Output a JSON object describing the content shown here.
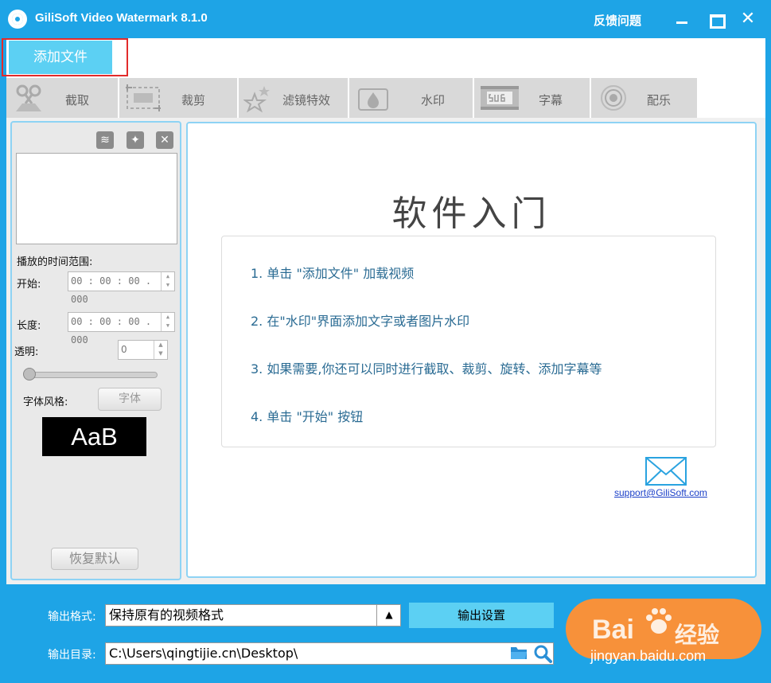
{
  "window": {
    "title": "GiliSoft Video Watermark 8.1.0",
    "feedback": "反馈问题",
    "close_glyph": "✕"
  },
  "add_file": {
    "label": "添加文件"
  },
  "toolbar": {
    "tools": [
      {
        "label": "截取",
        "icon": "scissors-icon"
      },
      {
        "label": "裁剪",
        "icon": "crop-icon"
      },
      {
        "label": "滤镜特效",
        "icon": "stars-icon"
      },
      {
        "label": "水印",
        "icon": "water-drop-icon"
      },
      {
        "label": "字幕",
        "icon": "subtitle-icon"
      },
      {
        "label": "配乐",
        "icon": "music-ring-icon"
      }
    ]
  },
  "left_panel": {
    "play_range_label": "播放的时间范围:",
    "start_label": "开始:",
    "start_value": "00 : 00 : 00 . 000",
    "length_label": "长度:",
    "length_value": "00 : 00 : 00 . 000",
    "opacity_label": "透明:",
    "opacity_value": "0",
    "font_style_label": "字体风格:",
    "font_button": "字体",
    "font_preview": "AaB",
    "restore_default": "恢复默认"
  },
  "guide": {
    "title": "软件入门",
    "steps": [
      "1. 单击 \"添加文件\" 加载视频",
      "2. 在\"水印\"界面添加文字或者图片水印",
      "3. 如果需要,你还可以同时进行截取、裁剪、旋转、添加字幕等",
      "4. 单击 \"开始\" 按钮"
    ],
    "support_email": "support@GiliSoft.com"
  },
  "bottom": {
    "format_label": "输出格式:",
    "format_value": "保持原有的视频格式",
    "output_settings": "输出设置",
    "dir_label": "输出目录:",
    "dir_value": "C:\\Users\\qingtijie.cn\\Desktop\\"
  },
  "watermark": {
    "brand_left": "Bai",
    "brand_right": "经验",
    "url": "jingyan.baidu.com"
  },
  "colors": {
    "frame": "#1ea4e6",
    "accent_button": "#5cd0f3",
    "start_button": "#f7913a",
    "highlight": "#e22b2b"
  }
}
